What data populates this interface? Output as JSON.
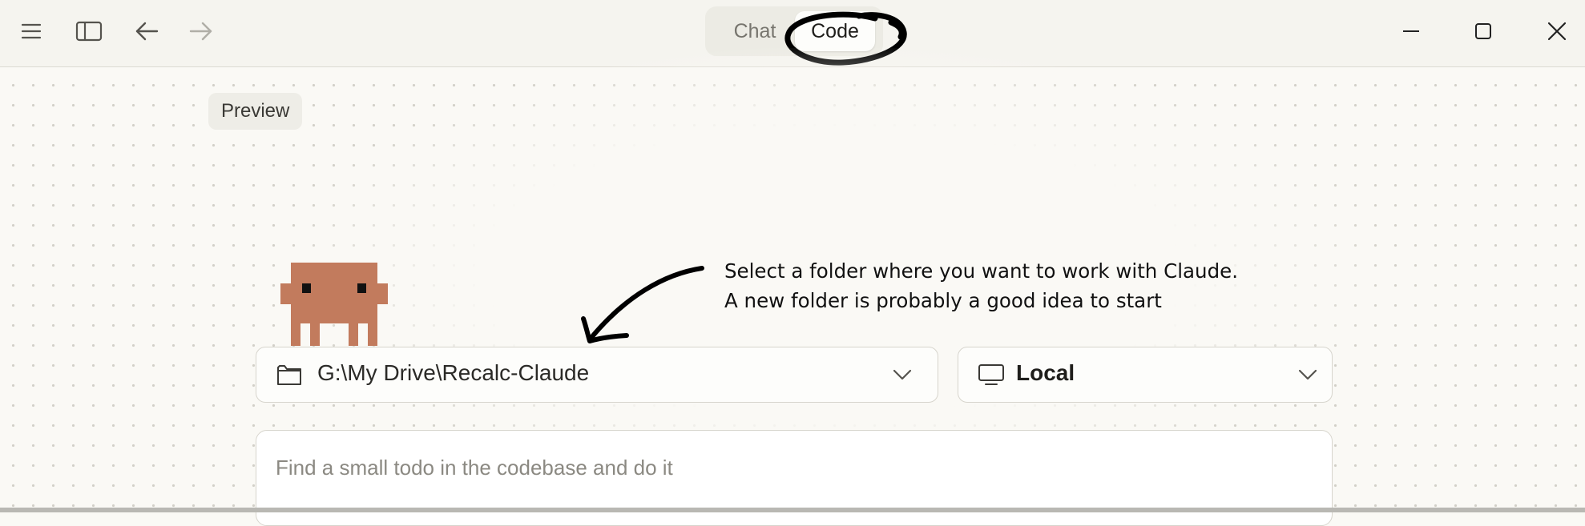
{
  "titlebar": {
    "menu_icon": "hamburger-menu-icon",
    "sidebar_icon": "sidebar-toggle-icon",
    "back_icon": "arrow-left-icon",
    "forward_icon": "arrow-right-icon",
    "mode_tabs": [
      {
        "label": "Chat",
        "selected": false
      },
      {
        "label": "Code",
        "selected": true
      }
    ],
    "window_controls": [
      "minimize-icon",
      "maximize-icon",
      "close-icon"
    ]
  },
  "main": {
    "preview_badge": "Preview",
    "annotation": {
      "line1": "Select a folder where you want to work with Claude.",
      "line2": "A new folder is probably a good idea to start"
    },
    "folder_dropdown": {
      "icon": "folder-icon",
      "value": "G:\\My Drive\\Recalc-Claude"
    },
    "environment_dropdown": {
      "icon": "monitor-icon",
      "value": "Local"
    },
    "prompt": {
      "placeholder": "Find a small todo in the codebase and do it"
    }
  },
  "colors": {
    "mascot": "#c27b5d",
    "background": "#faf9f5",
    "titlebar": "#f5f4ef"
  }
}
